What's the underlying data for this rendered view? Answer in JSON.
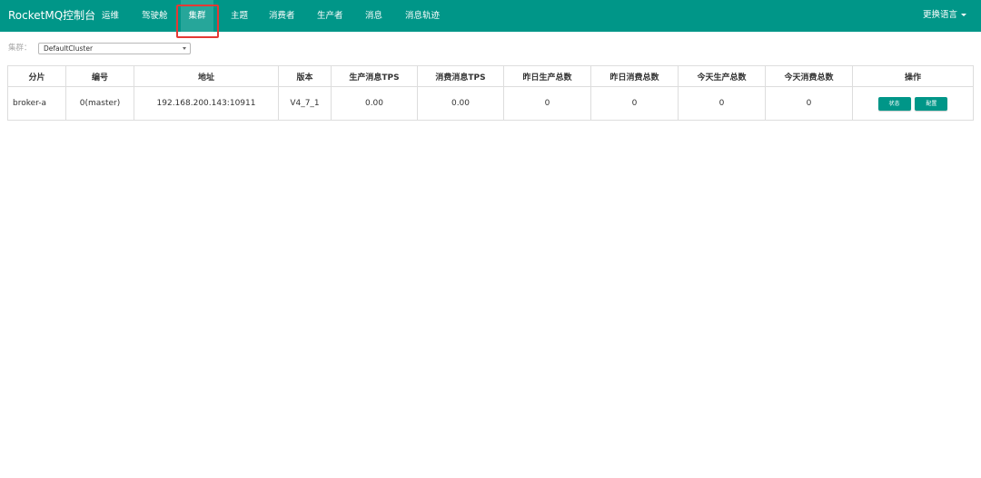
{
  "nav": {
    "brand": "RocketMQ控制台",
    "items": [
      {
        "label": "运维"
      },
      {
        "label": "驾驶舱"
      },
      {
        "label": "集群"
      },
      {
        "label": "主题"
      },
      {
        "label": "消费者"
      },
      {
        "label": "生产者"
      },
      {
        "label": "消息"
      },
      {
        "label": "消息轨迹"
      }
    ],
    "active_index": 2,
    "language": "更换语言"
  },
  "cluster_filter": {
    "label": "集群：",
    "selected": "DefaultCluster"
  },
  "table": {
    "headers": [
      "分片",
      "编号",
      "地址",
      "版本",
      "生产消息TPS",
      "消费消息TPS",
      "昨日生产总数",
      "昨日消费总数",
      "今天生产总数",
      "今天消费总数",
      "操作"
    ],
    "rows": [
      {
        "shard": "broker-a",
        "id": "0(master)",
        "address": "192.168.200.143:10911",
        "version": "V4_7_1",
        "produce_tps": "0.00",
        "consume_tps": "0.00",
        "yesterday_produce": "0",
        "yesterday_consume": "0",
        "today_produce": "0",
        "today_consume": "0",
        "actions": {
          "status": "状态",
          "config": "配置"
        }
      }
    ]
  },
  "colors": {
    "navbar": "#009688",
    "active_tab": "#26a69a",
    "button": "#009688",
    "highlight": "#e53935"
  },
  "icons": {
    "language_dropdown": "caret-down-icon",
    "select_dropdown": "select-arrow-icon"
  }
}
